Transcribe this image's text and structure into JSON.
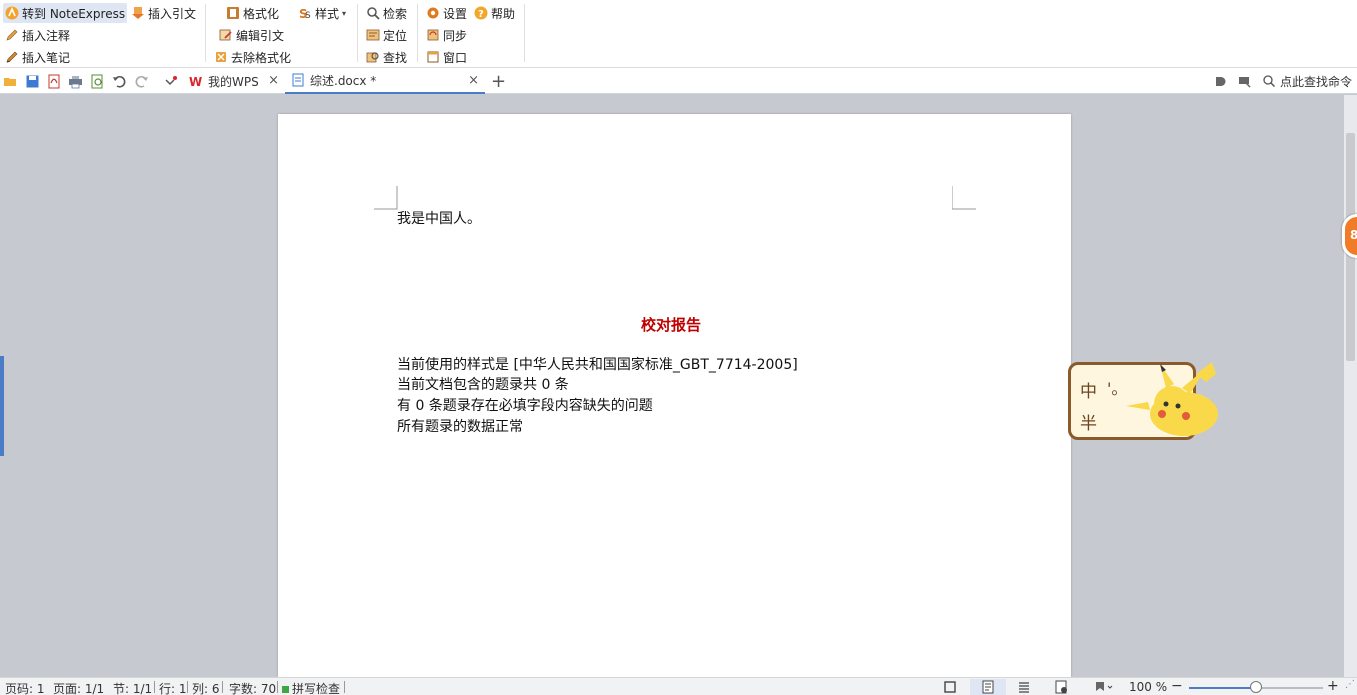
{
  "ribbon": {
    "noteexpress": {
      "goto": "转到 NoteExpress",
      "insert_citation": "插入引文",
      "insert_note": "插入注释",
      "insert_memo": "插入笔记"
    },
    "format": {
      "format": "格式化",
      "style": "样式",
      "edit_citation": "编辑引文",
      "remove_format": "去除格式化"
    },
    "search": {
      "retrieve": "检索",
      "locate": "定位",
      "find": "查找"
    },
    "settings": {
      "settings": "设置",
      "help": "帮助",
      "sync": "同步",
      "window": "窗口"
    }
  },
  "tabs": [
    {
      "label": "我的WPS",
      "close": "×"
    },
    {
      "label": "综述.docx *",
      "close": "×"
    }
  ],
  "tab_add": "+",
  "find_command": "点此查找命令",
  "document": {
    "line1": "我是中国人。",
    "report_title": "校对报告",
    "report_lines": [
      "当前使用的样式是  [中华人民共和国国家标准_GBT_7714-2005]",
      "当前文档包含的题录共 0 条",
      "有 0 条题录存在必填字段内容缺失的问题",
      "所有题录的数据正常"
    ]
  },
  "ime": {
    "mode": "中",
    "width": "半",
    "punct": "'。"
  },
  "float_ball": "8",
  "status": {
    "page_code": "页码: 1",
    "page": "页面: 1/1",
    "section": "节: 1/1",
    "row": "行: 1",
    "col": "列: 6",
    "word_count": "字数: 70",
    "spell_check": "拼写检查",
    "zoom": "100 %",
    "zoom_level": 100
  },
  "colors": {
    "accent": "#4a7cc7",
    "report_title": "#c00000",
    "ime_border": "#8a5a2b",
    "float_ball": "#f07c2a"
  }
}
